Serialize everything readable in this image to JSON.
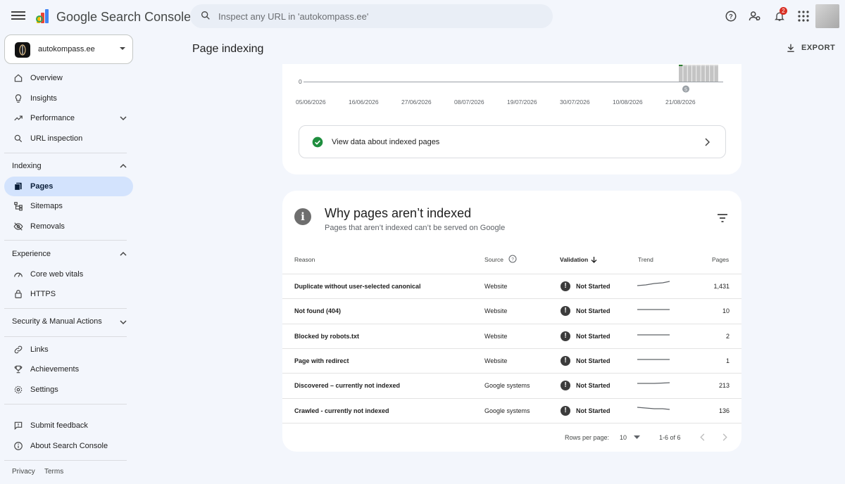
{
  "app": {
    "brand": "Google Search Console"
  },
  "search": {
    "placeholder": "Inspect any URL in 'autokompass.ee'"
  },
  "header": {
    "notifications_count": "2"
  },
  "property": {
    "name": "autokompass.ee"
  },
  "sidebar": {
    "top_items": [
      {
        "label": "Overview",
        "icon": "home-icon"
      },
      {
        "label": "Insights",
        "icon": "lightbulb-icon"
      },
      {
        "label": "Performance",
        "icon": "trending-up-icon"
      },
      {
        "label": "URL inspection",
        "icon": "search-icon"
      }
    ],
    "indexing": {
      "heading": "Indexing",
      "items": [
        {
          "label": "Pages",
          "icon": "pages-icon",
          "active": true
        },
        {
          "label": "Sitemaps",
          "icon": "sitemap-icon"
        },
        {
          "label": "Removals",
          "icon": "visibility-off-icon"
        }
      ]
    },
    "experience": {
      "heading": "Experience",
      "items": [
        {
          "label": "Core web vitals",
          "icon": "speed-icon"
        },
        {
          "label": "HTTPS",
          "icon": "lock-icon"
        }
      ]
    },
    "security": {
      "heading": "Security & Manual Actions"
    },
    "bottom_items": [
      {
        "label": "Links",
        "icon": "link-icon"
      },
      {
        "label": "Achievements",
        "icon": "trophy-icon"
      },
      {
        "label": "Settings",
        "icon": "settings-icon"
      }
    ],
    "extra_items": [
      {
        "label": "Submit feedback",
        "icon": "feedback-icon"
      },
      {
        "label": "About Search Console",
        "icon": "info-icon"
      }
    ],
    "footer": {
      "privacy": "Privacy",
      "terms": "Terms"
    }
  },
  "main": {
    "title": "Page indexing",
    "export_label": "EXPORT"
  },
  "chart_data": {
    "type": "bar",
    "y_axis_label_zero": "0",
    "x_ticks": [
      "05/06/2026",
      "16/06/2026",
      "27/06/2026",
      "08/07/2026",
      "19/07/2026",
      "30/07/2026",
      "10/08/2026",
      "21/08/2026"
    ],
    "annotation_marker": "5",
    "series_colors": {
      "indexed": "#2e7d32",
      "not_indexed": "#c4c4c4"
    }
  },
  "indexed_link": {
    "label": "View data about indexed pages"
  },
  "why": {
    "title": "Why pages aren’t indexed",
    "subtitle": "Pages that aren’t indexed can’t be served on Google",
    "columns": {
      "reason": "Reason",
      "source": "Source",
      "validation": "Validation",
      "trend": "Trend",
      "pages": "Pages"
    },
    "rows": [
      {
        "reason": "Duplicate without user-selected canonical",
        "source": "Website",
        "validation": "Not Started",
        "pages": "1,431"
      },
      {
        "reason": "Not found (404)",
        "source": "Website",
        "validation": "Not Started",
        "pages": "10"
      },
      {
        "reason": "Blocked by robots.txt",
        "source": "Website",
        "validation": "Not Started",
        "pages": "2"
      },
      {
        "reason": "Page with redirect",
        "source": "Website",
        "validation": "Not Started",
        "pages": "1"
      },
      {
        "reason": "Discovered – currently not indexed",
        "source": "Google systems",
        "validation": "Not Started",
        "pages": "213"
      },
      {
        "reason": "Crawled - currently not indexed",
        "source": "Google systems",
        "validation": "Not Started",
        "pages": "136"
      }
    ],
    "pagination": {
      "rows_per_page_label": "Rows per page:",
      "rows_per_page": "10",
      "range": "1-6 of 6"
    }
  },
  "colors": {
    "active_nav": "#d3e3fd",
    "background": "#f3f6fc",
    "success": "#1e8e3e"
  }
}
